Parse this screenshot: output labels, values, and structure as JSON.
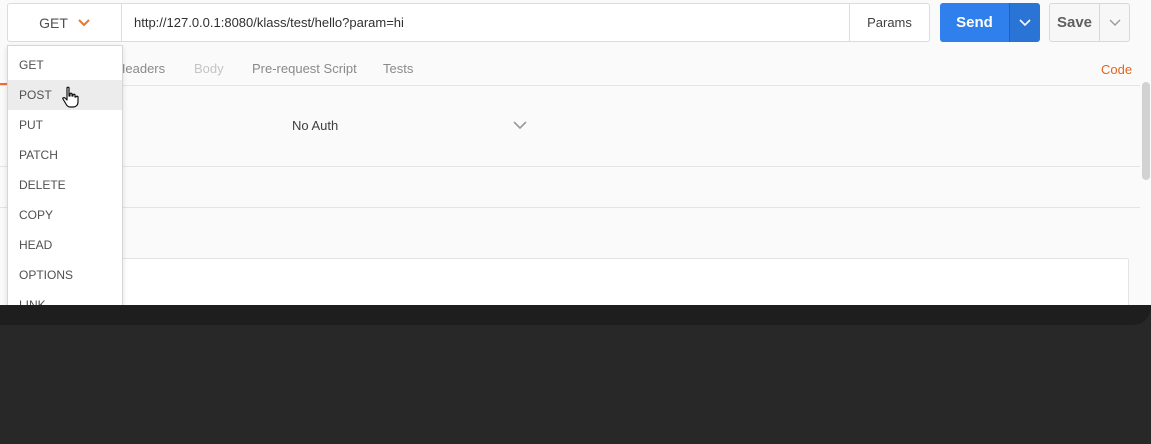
{
  "request": {
    "method": "GET",
    "url": "http://127.0.0.1:8080/klass/test/hello?param=hi",
    "params_label": "Params",
    "send_label": "Send",
    "save_label": "Save"
  },
  "tabs": {
    "headers": "Headers",
    "body": "Body",
    "prerequest": "Pre-request Script",
    "tests": "Tests",
    "code": "Code"
  },
  "auth": {
    "type": "No Auth"
  },
  "method_menu": {
    "items": [
      "GET",
      "POST",
      "PUT",
      "PATCH",
      "DELETE",
      "COPY",
      "HEAD",
      "OPTIONS",
      "LINK"
    ],
    "hovered": "POST"
  },
  "colors": {
    "send": "#2f80ed",
    "accent": "#e0661c",
    "chevron": "#e07b2d"
  }
}
